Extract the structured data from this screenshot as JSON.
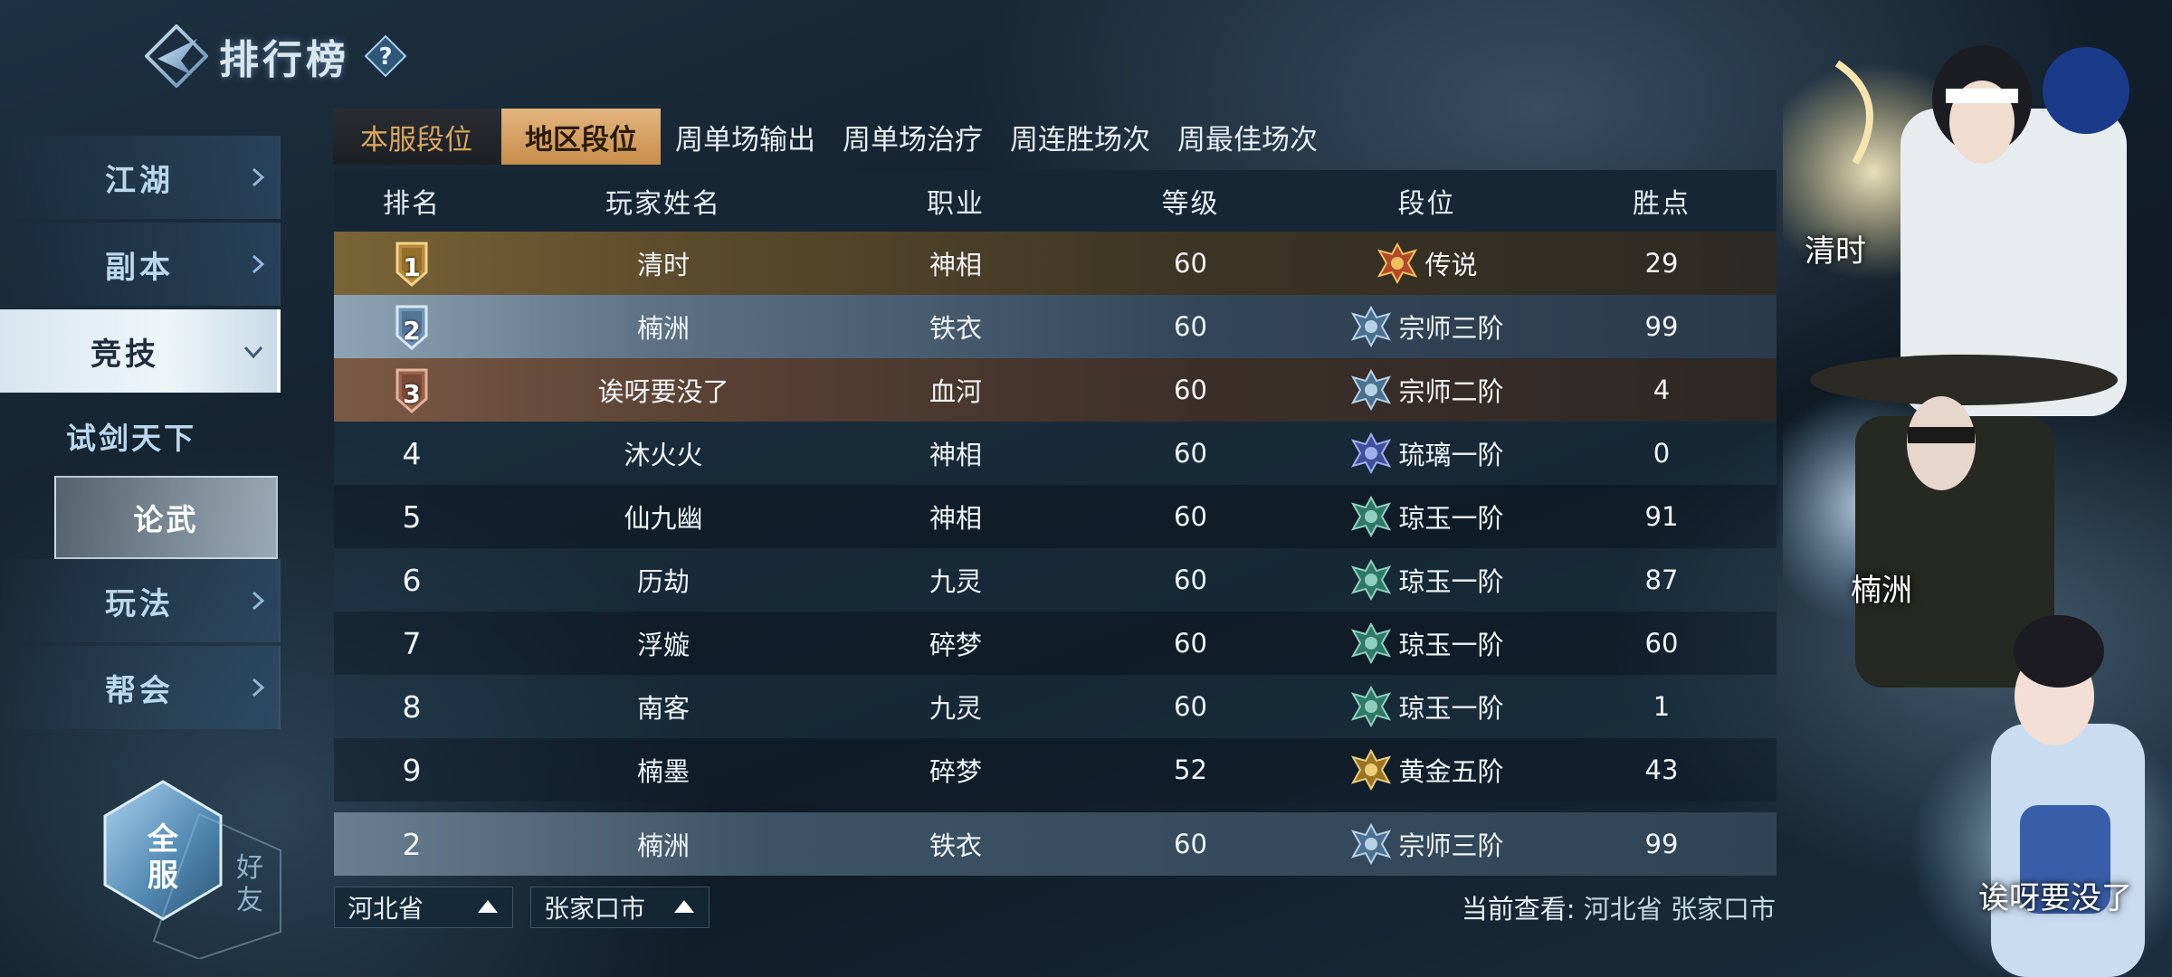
{
  "header": {
    "title": "排行榜",
    "help": "?"
  },
  "nav": {
    "items": [
      {
        "label": "江湖"
      },
      {
        "label": "副本"
      },
      {
        "label": "竞技"
      }
    ],
    "sub_items": [
      {
        "label": "试剑天下"
      },
      {
        "label": "论武"
      }
    ],
    "items_after": [
      {
        "label": "玩法"
      },
      {
        "label": "帮会"
      }
    ]
  },
  "scope_toggle": {
    "main": "全服",
    "alt": "好友"
  },
  "tabs": [
    "本服段位",
    "地区段位",
    "周单场输出",
    "周单场治疗",
    "周连胜场次",
    "周最佳场次"
  ],
  "table": {
    "headers": [
      "排名",
      "玩家姓名",
      "职业",
      "等级",
      "段位",
      "胜点"
    ],
    "rows": [
      {
        "rank": "1",
        "name": "清时",
        "job": "神相",
        "level": "60",
        "tier": "传说",
        "points": "29"
      },
      {
        "rank": "2",
        "name": "楠洲",
        "job": "铁衣",
        "level": "60",
        "tier": "宗师三阶",
        "points": "99"
      },
      {
        "rank": "3",
        "name": "诶呀要没了",
        "job": "血河",
        "level": "60",
        "tier": "宗师二阶",
        "points": "4"
      },
      {
        "rank": "4",
        "name": "沐火火",
        "job": "神相",
        "level": "60",
        "tier": "琉璃一阶",
        "points": "0"
      },
      {
        "rank": "5",
        "name": "仙九幽",
        "job": "神相",
        "level": "60",
        "tier": "琼玉一阶",
        "points": "91"
      },
      {
        "rank": "6",
        "name": "历劫",
        "job": "九灵",
        "level": "60",
        "tier": "琼玉一阶",
        "points": "87"
      },
      {
        "rank": "7",
        "name": "浮嫙",
        "job": "碎梦",
        "level": "60",
        "tier": "琼玉一阶",
        "points": "60"
      },
      {
        "rank": "8",
        "name": "南客",
        "job": "九灵",
        "level": "60",
        "tier": "琼玉一阶",
        "points": "1"
      },
      {
        "rank": "9",
        "name": "楠墨",
        "job": "碎梦",
        "level": "52",
        "tier": "黄金五阶",
        "points": "43"
      }
    ],
    "my_row": {
      "rank": "2",
      "name": "楠洲",
      "job": "铁衣",
      "level": "60",
      "tier": "宗师三阶",
      "points": "99"
    }
  },
  "filters": {
    "province": "河北省",
    "city": "张家口市"
  },
  "current_view": {
    "label": "当前查看:",
    "value": "河北省 张家口市"
  },
  "showcase": [
    "清时",
    "楠洲",
    "诶呀要没了"
  ],
  "colors": {
    "tab_active": "#e2b57d",
    "tab_first_text": "#d9a661",
    "gold_row": "#7a6437",
    "silver_row": "#8fa3b5",
    "bronze_row": "#7a5a45"
  }
}
